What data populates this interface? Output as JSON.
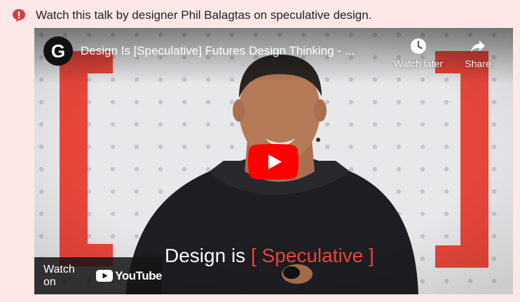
{
  "notice": {
    "text": "Watch this talk by designer Phil Balagtas on speculative design.",
    "icon": "exclamation-icon",
    "accent_color": "#d93c3c"
  },
  "video": {
    "title": "Design Is [Speculative] Futures Design Thinking - ...",
    "channel_initial": "G",
    "watch_later_label": "Watch later",
    "share_label": "Share",
    "caption_prefix": "Design is ",
    "caption_open_bracket": "[",
    "caption_accent": " Speculative ",
    "caption_close_bracket": "]",
    "watch_on_label": "Watch on",
    "youtube_label": "YouTube",
    "play_color": "#ff0000",
    "bracket_color": "#e8463a"
  }
}
